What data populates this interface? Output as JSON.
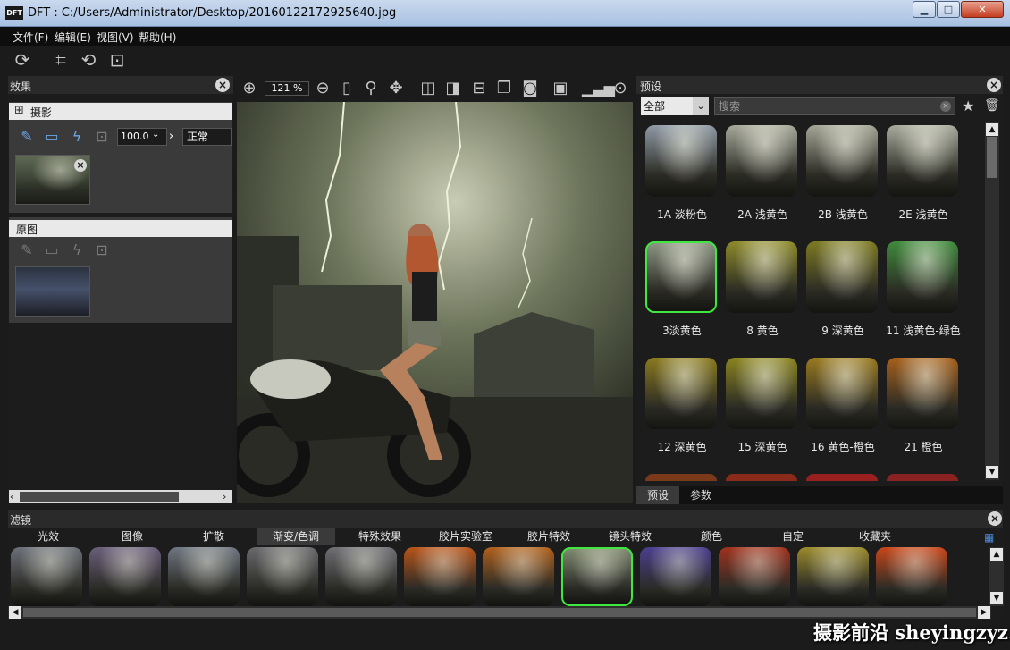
{
  "window": {
    "app_icon": "DFT",
    "title": "DFT : C:/Users/Administrator/Desktop/20160122172925640.jpg",
    "minimize": "▁",
    "maximize": "□",
    "close": "✕"
  },
  "menu": {
    "items": [
      "文件(F)",
      "编辑(E)",
      "视图(V)",
      "帮助(H)"
    ]
  },
  "toolbar": {
    "icons": [
      "refresh-icon",
      "crop-icon",
      "rotate-icon",
      "fit-icon"
    ]
  },
  "effects_panel": {
    "title": "效果",
    "layer1": {
      "name": "摄影",
      "opacity": "100.0",
      "blend_mode": "正常"
    },
    "layer2": {
      "name": "原图"
    }
  },
  "view_toolbar": {
    "zoom": "121 %"
  },
  "preset_panel": {
    "title": "预设",
    "category": "全部",
    "search_placeholder": "搜索",
    "presets": [
      {
        "label": "1A 淡粉色",
        "tint": "#8f9aa5"
      },
      {
        "label": "2A 浅黄色",
        "tint": "#a6a89a"
      },
      {
        "label": "2B 浅黄色",
        "tint": "#a5a596"
      },
      {
        "label": "2E 浅黄色",
        "tint": "#a8ab9c"
      },
      {
        "label": "3淡黄色",
        "tint": "#8c9482",
        "selected": true
      },
      {
        "label": "8 黄色",
        "tint": "#8d8a2a"
      },
      {
        "label": "9 深黄色",
        "tint": "#7d7a22"
      },
      {
        "label": "11 浅黄色-绿色",
        "tint": "#3f8a3c"
      },
      {
        "label": "12 深黄色",
        "tint": "#8a7a1e"
      },
      {
        "label": "15 深黄色",
        "tint": "#8a8420"
      },
      {
        "label": "16 黄色-橙色",
        "tint": "#9a7a20"
      },
      {
        "label": "21 橙色",
        "tint": "#a6601c"
      }
    ],
    "bottom_tabs": [
      "预设",
      "参数"
    ]
  },
  "filter_panel": {
    "title": "滤镜",
    "tabs": [
      "光效",
      "图像",
      "扩散",
      "渐变/色调",
      "特殊效果",
      "胶片实验室",
      "胶片特效",
      "镜头特效",
      "颜色",
      "自定",
      "收藏夹"
    ],
    "active_tab": "渐变/色调",
    "thumbnails": [
      {
        "tint": "#6c7078"
      },
      {
        "tint": "#6a5e7a"
      },
      {
        "tint": "#6f7680"
      },
      {
        "tint": "#6a6a6e"
      },
      {
        "tint": "#6f6f75"
      },
      {
        "tint": "#b8541a"
      },
      {
        "tint": "#b0601c"
      },
      {
        "tint": "#7f8a70",
        "selected": true
      },
      {
        "tint": "#4a3f8e"
      },
      {
        "tint": "#a0321e"
      },
      {
        "tint": "#9a8a2c"
      },
      {
        "tint": "#c8461a"
      }
    ]
  },
  "watermark": "摄影前沿 sheyingzyz.com"
}
